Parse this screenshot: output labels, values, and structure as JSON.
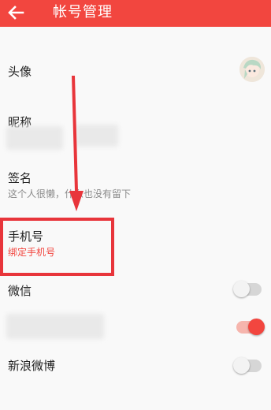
{
  "appbar": {
    "title": "帐号管理",
    "back_icon": "arrow-left-icon",
    "background": "#f2463f"
  },
  "rows": {
    "avatar": {
      "label": "头像"
    },
    "nickname": {
      "label": "昵称"
    },
    "signature": {
      "label": "签名",
      "value": "这个人很懒，什么也没有留下"
    },
    "phone": {
      "label": "手机号",
      "action": "绑定手机号"
    },
    "wechat": {
      "label": "微信",
      "toggle": "off"
    },
    "hidden_account": {
      "toggle": "on"
    },
    "weibo": {
      "label": "新浪微博",
      "toggle": "off"
    }
  },
  "colors": {
    "accent": "#f2463f",
    "highlight_box": "#e8353b",
    "arrow": "#e8353b"
  }
}
